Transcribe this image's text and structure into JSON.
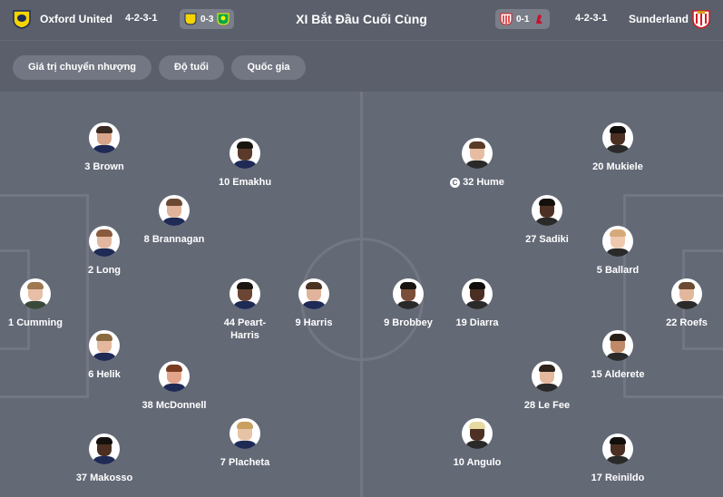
{
  "header": {
    "title": "XI Bắt Đầu Cuối Cùng",
    "home": {
      "name": "Oxford United",
      "formation": "4-2-3-1",
      "crest": "oxford-crest-icon",
      "last_result": "0-3",
      "last_opponent_crest": "norwich-crest-icon"
    },
    "away": {
      "name": "Sunderland",
      "formation": "4-2-3-1",
      "crest": "sunderland-crest-icon",
      "last_result": "0-1",
      "last_own_crest": "sunderland-crest-icon",
      "last_opponent_crest": "liverpool-crest-icon"
    }
  },
  "filters": [
    "Giá trị chuyển nhượng",
    "Độ tuổi",
    "Quốc gia"
  ],
  "colors": {
    "background": "#5e6370",
    "pitch": "#646976",
    "pitch_lines": "#737783",
    "chip": "#737783"
  },
  "home_players": [
    {
      "label": "3 Brown",
      "skin": "#d9a58a",
      "hair": "#3a2a22",
      "shirt": "#1f2a55"
    },
    {
      "label": "10 Emakhu",
      "skin": "#5a3a2a",
      "hair": "#1a1410",
      "shirt": "#1f2a55"
    },
    {
      "label": "8 Brannagan",
      "skin": "#e0b39a",
      "hair": "#6b4a33",
      "shirt": "#1f2a55"
    },
    {
      "label": "2 Long",
      "skin": "#e2b7a0",
      "hair": "#8a5a3c",
      "shirt": "#1f2a55"
    },
    {
      "label": "1 Cumming",
      "skin": "#e6bfa6",
      "hair": "#a07850",
      "shirt": "#3a4a3a"
    },
    {
      "label": "44 Peart-\nHarris",
      "skin": "#6b4634",
      "hair": "#1b1512",
      "shirt": "#1f2a55"
    },
    {
      "label": "9 Harris",
      "skin": "#e0b39a",
      "hair": "#4b3322",
      "shirt": "#1f2a55"
    },
    {
      "label": "6 Helik",
      "skin": "#e4b89c",
      "hair": "#8a6a40",
      "shirt": "#1f2a55"
    },
    {
      "label": "38 McDonnell",
      "skin": "#e3a48c",
      "hair": "#7a3d22",
      "shirt": "#1f2a55"
    },
    {
      "label": "37 Makosso",
      "skin": "#4a2f22",
      "hair": "#15100d",
      "shirt": "#1f2a55"
    },
    {
      "label": "7 Placheta",
      "skin": "#e7c3a6",
      "hair": "#c9a060",
      "shirt": "#1f2a55"
    }
  ],
  "away_players": [
    {
      "label": "32 Hume",
      "captain": true,
      "skin": "#e6bca2",
      "hair": "#5a3b26",
      "shirt": "#2a2a2a"
    },
    {
      "label": "20 Mukiele",
      "skin": "#4a2f22",
      "hair": "#120e0b",
      "shirt": "#2a2a2a"
    },
    {
      "label": "27 Sadiki",
      "skin": "#4e3124",
      "hair": "#14100c",
      "shirt": "#2a2a2a"
    },
    {
      "label": "5 Ballard",
      "skin": "#efc9ae",
      "hair": "#d6a97a",
      "shirt": "#2a2a2a"
    },
    {
      "label": "9 Brobbey",
      "skin": "#7a4e38",
      "hair": "#1a1410",
      "shirt": "#2a2a2a"
    },
    {
      "label": "19 Diarra",
      "skin": "#4a2f22",
      "hair": "#120e0b",
      "shirt": "#2a2a2a"
    },
    {
      "label": "22 Roefs",
      "skin": "#e2b79c",
      "hair": "#6b4a33",
      "shirt": "#2a2a2a"
    },
    {
      "label": "15 Alderete",
      "skin": "#c08a68",
      "hair": "#2a1f18",
      "shirt": "#2a2a2a"
    },
    {
      "label": "28 Le Fee",
      "skin": "#e4b89c",
      "hair": "#2e241c",
      "shirt": "#2a2a2a"
    },
    {
      "label": "10 Angulo",
      "skin": "#4e3124",
      "hair": "#e8d9a0",
      "shirt": "#2a2a2a"
    },
    {
      "label": "17 Reinildo",
      "skin": "#4a2f22",
      "hair": "#120e0b",
      "shirt": "#2a2a2a"
    }
  ]
}
